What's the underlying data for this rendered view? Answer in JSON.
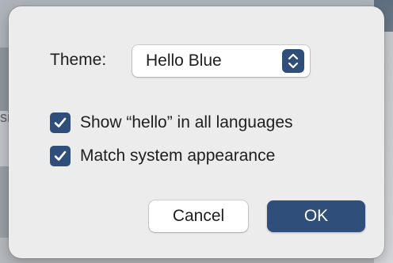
{
  "dialog": {
    "theme_label": "Theme:",
    "theme_popup": {
      "value": "Hello Blue"
    },
    "options": [
      {
        "label": "Show “hello” in all languages",
        "checked": true
      },
      {
        "label": "Match system appearance",
        "checked": true
      }
    ],
    "buttons": {
      "cancel": "Cancel",
      "ok": "OK"
    }
  },
  "background": {
    "partial_text": "si"
  },
  "colors": {
    "accent": "#2f4e7a",
    "sheet": "#ececec",
    "text": "#1e1e1e"
  },
  "icons": {
    "popup_stepper": "chevron-up-down-icon",
    "checkmark": "checkmark-icon"
  }
}
